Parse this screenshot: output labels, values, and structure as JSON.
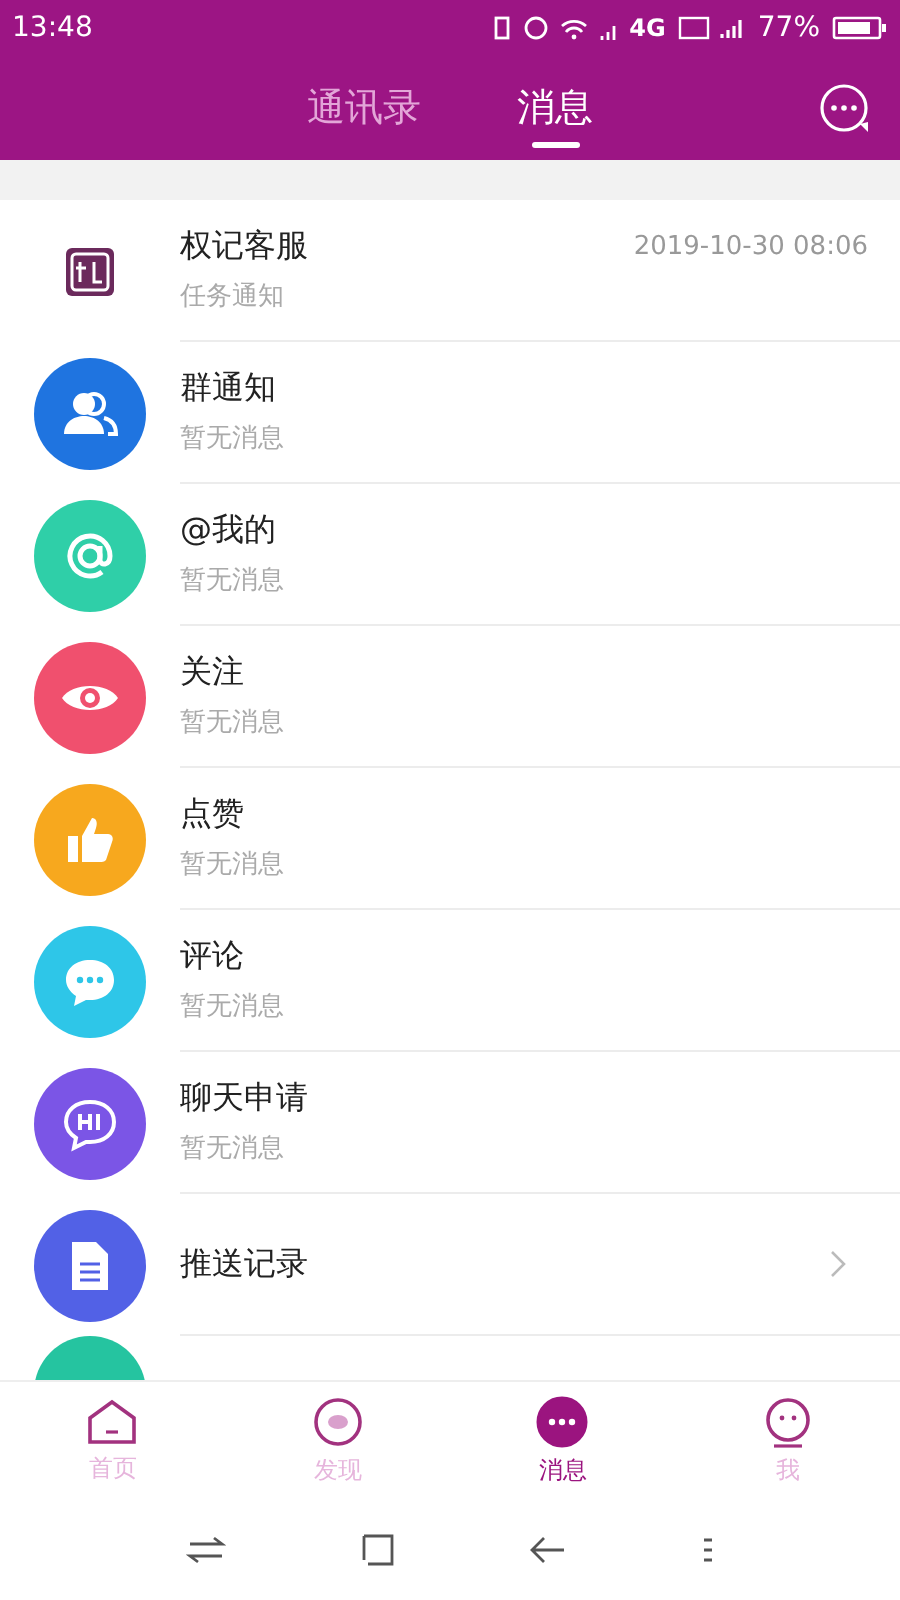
{
  "status_bar": {
    "time": "13:48",
    "network": "4G",
    "battery": "77%"
  },
  "header": {
    "tabs": [
      {
        "label": "通讯录",
        "selected": false
      },
      {
        "label": "消息",
        "selected": true
      }
    ]
  },
  "messages": [
    {
      "kind": "logo",
      "color": "#6b2a5c",
      "title": "权记客服",
      "subtitle": "任务通知",
      "time": "2019-10-30 08:06"
    },
    {
      "kind": "group",
      "color": "#1f74e0",
      "title": "群通知",
      "subtitle": "暂无消息"
    },
    {
      "kind": "at",
      "color": "#2fcfa8",
      "title": "@我的",
      "subtitle": "暂无消息"
    },
    {
      "kind": "eye",
      "color": "#f0506e",
      "title": "关注",
      "subtitle": "暂无消息"
    },
    {
      "kind": "like",
      "color": "#f7a81e",
      "title": "点赞",
      "subtitle": "暂无消息"
    },
    {
      "kind": "comment",
      "color": "#2ec6e8",
      "title": "评论",
      "subtitle": "暂无消息"
    },
    {
      "kind": "hi",
      "color": "#7b55e6",
      "title": "聊天申请",
      "subtitle": "暂无消息"
    },
    {
      "kind": "doc",
      "color": "#5261e6",
      "title": "推送记录",
      "chevron": true
    },
    {
      "kind": "partial",
      "color": "#25c4a0"
    }
  ],
  "tab_bar": [
    {
      "label": "首页",
      "kind": "home",
      "selected": false
    },
    {
      "label": "发现",
      "kind": "discover",
      "selected": false
    },
    {
      "label": "消息",
      "kind": "message",
      "selected": true
    },
    {
      "label": "我",
      "kind": "me",
      "selected": false
    }
  ]
}
